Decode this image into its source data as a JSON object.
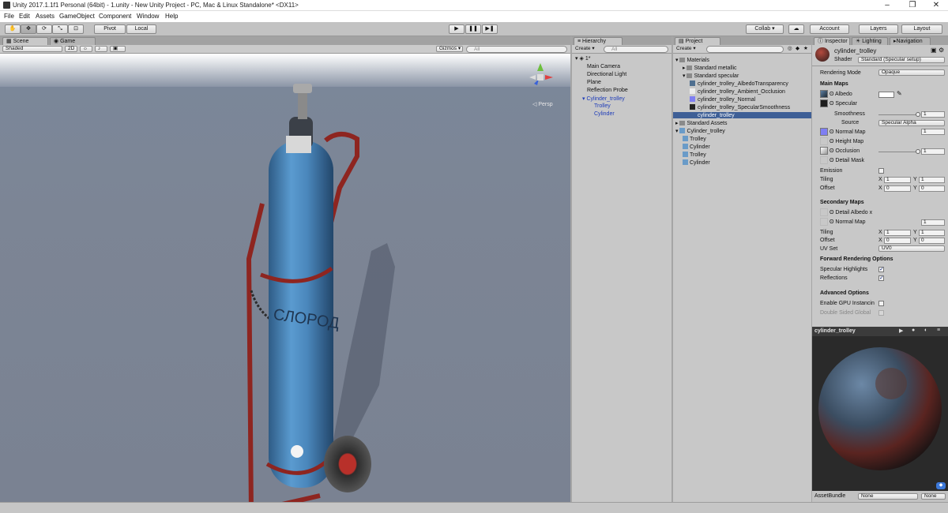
{
  "window": {
    "title": "Unity 2017.1.1f1 Personal (64bit) - 1.unity - New Unity Project - PC, Mac & Linux Standalone* <DX11>",
    "controls": [
      "–",
      "❐",
      "✕"
    ]
  },
  "menu": [
    "File",
    "Edit",
    "Assets",
    "GameObject",
    "Component",
    "Window",
    "Help"
  ],
  "toolbar": {
    "pivot": "Pivot",
    "local": "Local",
    "collab": "Collab ▾",
    "account": "Account",
    "layers": "Layers",
    "layout": "Layout"
  },
  "scene": {
    "tabs": [
      "Scene",
      "Game"
    ],
    "shading": "Shaded",
    "mode2d": "2D",
    "gizmos": "Gizmos ▾",
    "search_placeholder": "All",
    "persp": "◁ Persp",
    "bottle_text": "СЛОРОД"
  },
  "hierarchy": {
    "tab": "Hierarchy",
    "create": "Create ▾",
    "search_placeholder": "All",
    "scene_name": "1*",
    "items": [
      {
        "label": "Main Camera",
        "indent": 1,
        "blue": false
      },
      {
        "label": "Directional Light",
        "indent": 1,
        "blue": false
      },
      {
        "label": "Plane",
        "indent": 1,
        "blue": false
      },
      {
        "label": "Reflection Probe",
        "indent": 1,
        "blue": false
      },
      {
        "label": "Cylinder_trolley",
        "indent": 1,
        "blue": true
      },
      {
        "label": "Trolley",
        "indent": 2,
        "blue": true
      },
      {
        "label": "Cylinder",
        "indent": 2,
        "blue": true
      }
    ]
  },
  "project": {
    "tab": "Project",
    "create": "Create ▾",
    "items": [
      {
        "label": "Materials",
        "indent": 0
      },
      {
        "label": "Standard metallic",
        "indent": 1
      },
      {
        "label": "Standard specular",
        "indent": 1
      },
      {
        "label": "cylinder_trolley_AlbedoTransparency",
        "indent": 2
      },
      {
        "label": "cylinder_trolley_Ambient_Occlusion",
        "indent": 2
      },
      {
        "label": "cylinder_trolley_Normal",
        "indent": 2
      },
      {
        "label": "cylinder_trolley_SpecularSmoothness",
        "indent": 2
      },
      {
        "label": "cylinder_trolley",
        "indent": 2
      },
      {
        "label": "Standard Assets",
        "indent": 0
      },
      {
        "label": "Cylinder_trolley",
        "indent": 0
      },
      {
        "label": "Trolley",
        "indent": 1
      },
      {
        "label": "Cylinder",
        "indent": 1
      },
      {
        "label": "Trolley",
        "indent": 1
      },
      {
        "label": "Cylinder",
        "indent": 1
      }
    ]
  },
  "inspector": {
    "tabs": [
      "Inspector",
      "Lighting",
      "Navigation"
    ],
    "material_name": "cylinder_trolley",
    "shader_label": "Shader",
    "shader_value": "Standard (Specular setup)",
    "rendering_mode_label": "Rendering Mode",
    "rendering_mode_value": "Opaque",
    "main_maps": "Main Maps",
    "albedo": "Albedo",
    "specular": "Specular",
    "smoothness": "Smoothness",
    "smoothness_value": "1",
    "source": "Source",
    "source_value": "Specular Alpha",
    "normal_map": "Normal Map",
    "normal_value": "1",
    "height_map": "Height Map",
    "occlusion": "Occlusion",
    "occlusion_value": "1",
    "detail_mask": "Detail Mask",
    "emission": "Emission",
    "tiling": "Tiling",
    "offset": "Offset",
    "x_label": "X",
    "y_label": "Y",
    "tiling_x": "1",
    "tiling_y": "1",
    "offset_x": "0",
    "offset_y": "0",
    "secondary_maps": "Secondary Maps",
    "detail_albedo": "Detail Albedo x",
    "sec_normal_map": "Normal Map",
    "sec_normal_value": "1",
    "sec_tiling_x": "1",
    "sec_tiling_y": "1",
    "sec_offset_x": "0",
    "sec_offset_y": "0",
    "uv_set": "UV Set",
    "uv_set_value": "UV0",
    "forward_options": "Forward Rendering Options",
    "specular_highlights": "Specular Highlights",
    "reflections": "Reflections",
    "advanced_options": "Advanced Options",
    "gpu_instancing": "Enable GPU Instancin",
    "double_sided": "Double Sided Global",
    "smoothness_level": 1,
    "occlusion_level": 1
  },
  "preview": {
    "title": "cylinder_trolley",
    "assetbundle": "AssetBundle",
    "bundle_value": "None",
    "variant_value": "None"
  },
  "colors": {
    "cylinder_blue": "#4a8bc0",
    "trolley_red": "#9c2a22",
    "selection": "#3e5f96"
  }
}
